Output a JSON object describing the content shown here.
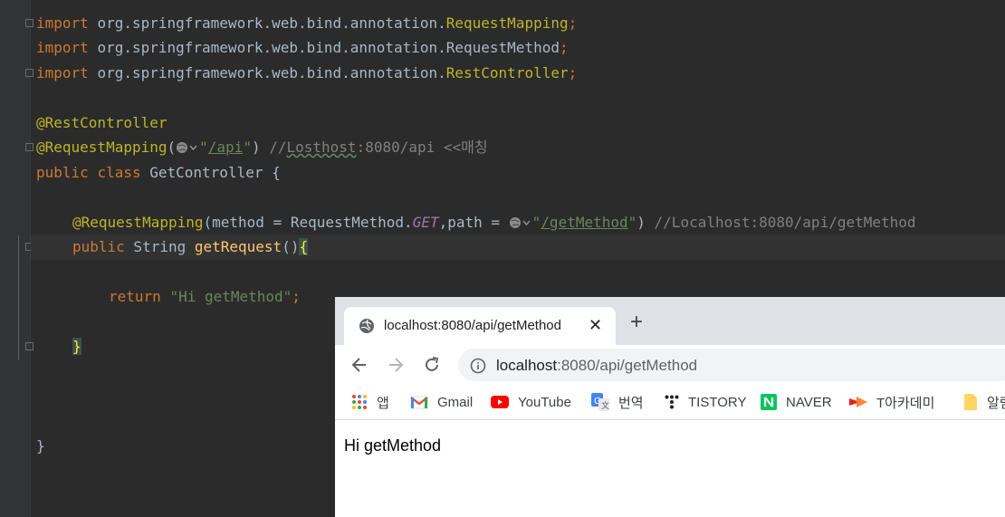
{
  "ide": {
    "imports": [
      {
        "kw": "import",
        "pkg": "org.springframework.web.bind.annotation.",
        "cls": "RequestMapping",
        "semi": ";"
      },
      {
        "kw": "import",
        "pkg": "org.springframework.web.bind.annotation.",
        "cls": "RequestMethod",
        "semi": ";"
      },
      {
        "kw": "import",
        "pkg": "org.springframework.web.bind.annotation.",
        "cls": "RestController",
        "semi": ";"
      }
    ],
    "rest_controller": "@RestController",
    "class_mapping": {
      "annotation": "@RequestMapping",
      "open": "(",
      "q1": "\"",
      "path": "/api",
      "q2": "\"",
      "close": ")",
      "comment_prefix": " //",
      "comment_word": "Losthost",
      "comment_rest": ":8080/api <<매칭"
    },
    "class_decl": {
      "public": "public",
      "class": "class",
      "rest": " GetController {"
    },
    "method_mapping": {
      "annotation": "@RequestMapping",
      "pre": "(method = RequestMethod.",
      "enum": "GET",
      "mid": ",path = ",
      "q1": "\"",
      "path": "/getMethod",
      "q2": "\"",
      "close": ")",
      "comment": " //Localhost:8080/api/getMethod"
    },
    "method_decl": {
      "public": "public",
      "type": " String ",
      "name": "getRequest",
      "parens": "()",
      "brace": "{"
    },
    "return_stmt": {
      "kw": "return",
      "value": " \"Hi getMethod\"",
      "semi": ";"
    },
    "method_close": "}",
    "class_close": "}"
  },
  "browser": {
    "tab_title": "localhost:8080/api/getMethod",
    "tab_close": "✕",
    "new_tab": "+",
    "url_host": "localhost",
    "url_path": ":8080/api/getMethod",
    "bookmarks": [
      {
        "label": "앱",
        "icon": "apps-grid-icon"
      },
      {
        "label": "Gmail",
        "icon": "gmail-icon"
      },
      {
        "label": "YouTube",
        "icon": "youtube-icon"
      },
      {
        "label": "번역",
        "icon": "google-translate-icon"
      },
      {
        "label": "TISTORY",
        "icon": "tistory-icon"
      },
      {
        "label": "NAVER",
        "icon": "naver-icon"
      },
      {
        "label": "T아카데미",
        "icon": "tacademy-icon"
      },
      {
        "label": "알림",
        "icon": "folder-icon"
      }
    ],
    "page_text": "Hi getMethod"
  },
  "colors": {
    "editor_bg": "#2b2b2b",
    "keyword": "#cc7832",
    "annotation": "#bbb529",
    "string": "#6a8759",
    "comment": "#808080",
    "method": "#ffc66d"
  }
}
